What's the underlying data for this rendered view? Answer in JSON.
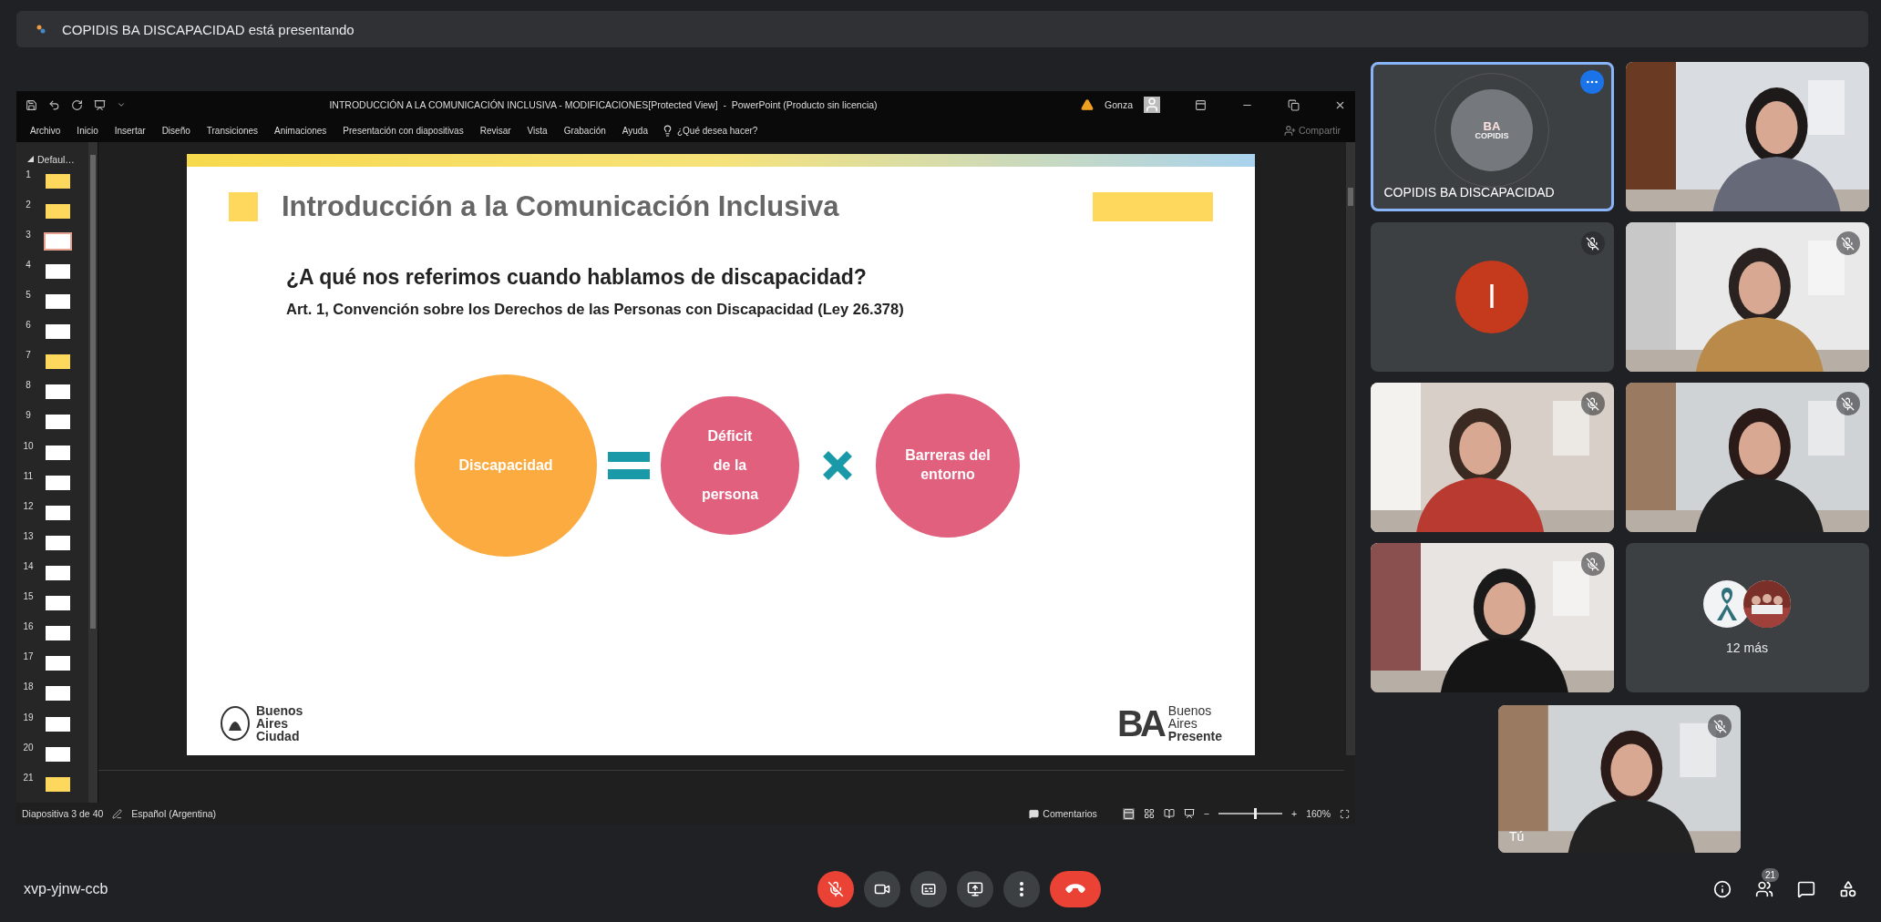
{
  "banner": {
    "text": "COPIDIS BA DISCAPACIDAD está presentando"
  },
  "powerpoint": {
    "title": "INTRODUCCIÓN A LA COMUNICACIÓN INCLUSIVA - MODIFICACIONES[Protected View]  -  PowerPoint (Producto sin licencia)",
    "user": "Gonza",
    "ribbon_tabs": [
      "Archivo",
      "Inicio",
      "Insertar",
      "Diseño",
      "Transiciones",
      "Animaciones",
      "Presentación con diapositivas",
      "Revisar",
      "Vista",
      "Grabación",
      "Ayuda"
    ],
    "tell_me": "¿Qué desea hacer?",
    "share": "Compartir",
    "section": "Defaul…",
    "thumbnails": [
      {
        "number": "1",
        "kind": "yellow",
        "selected": false
      },
      {
        "number": "2",
        "kind": "yellow",
        "selected": false
      },
      {
        "number": "3",
        "kind": "white",
        "selected": true
      },
      {
        "number": "4",
        "kind": "white",
        "selected": false
      },
      {
        "number": "5",
        "kind": "white",
        "selected": false
      },
      {
        "number": "6",
        "kind": "white",
        "selected": false
      },
      {
        "number": "7",
        "kind": "yellow",
        "selected": false
      },
      {
        "number": "8",
        "kind": "white",
        "selected": false
      },
      {
        "number": "9",
        "kind": "white",
        "selected": false
      },
      {
        "number": "10",
        "kind": "white",
        "selected": false
      },
      {
        "number": "11",
        "kind": "white",
        "selected": false
      },
      {
        "number": "12",
        "kind": "white",
        "selected": false
      },
      {
        "number": "13",
        "kind": "white",
        "selected": false
      },
      {
        "number": "14",
        "kind": "white",
        "selected": false
      },
      {
        "number": "15",
        "kind": "white",
        "selected": false
      },
      {
        "number": "16",
        "kind": "white",
        "selected": false
      },
      {
        "number": "17",
        "kind": "white",
        "selected": false
      },
      {
        "number": "18",
        "kind": "white",
        "selected": false
      },
      {
        "number": "19",
        "kind": "white",
        "selected": false
      },
      {
        "number": "20",
        "kind": "white",
        "selected": false
      },
      {
        "number": "21",
        "kind": "yellow",
        "selected": false
      }
    ],
    "slide": {
      "title": "Introducción a la Comunicación Inclusiva",
      "question": "¿A qué nos referimos cuando hablamos de discapacidad?",
      "reference": "Art. 1, Convención sobre los Derechos de las Personas con Discapacidad (Ley 26.378)",
      "equation": [
        {
          "kind": "circle",
          "lines": [
            "Discapacidad"
          ],
          "color": "#fbab3f"
        },
        {
          "kind": "equals"
        },
        {
          "kind": "circle",
          "lines": [
            "Déficit",
            "de la",
            "persona"
          ],
          "color": "#e0607e"
        },
        {
          "kind": "times"
        },
        {
          "kind": "circle",
          "lines": [
            "Barreras del",
            "entorno"
          ],
          "color": "#e0607e"
        }
      ],
      "logo_left": [
        "Buenos",
        "Aires",
        "Ciudad"
      ],
      "logo_right": {
        "mark": "BA",
        "lines": [
          "Buenos",
          "Aires",
          "Presente"
        ]
      }
    },
    "status_bar": {
      "slide_count": "Diapositiva 3 de 40",
      "language": "Español (Argentina)",
      "comments": "Comentarios",
      "zoom_minus": "−",
      "zoom_plus": "+",
      "zoom": {
        "level": 0.55
      },
      "zoom_reading": "160%"
    }
  },
  "participants": [
    {
      "kind": "logo",
      "name": "COPIDIS BA DISCAPACIDAD",
      "highlighted": true,
      "muted": false,
      "logo": {
        "mark": "BA",
        "name": "COPIDIS"
      }
    },
    {
      "kind": "video",
      "highlighted": false,
      "muted": false
    },
    {
      "kind": "avatar",
      "initial": "I",
      "color": "#c5391c",
      "highlighted": false,
      "muted": true
    },
    {
      "kind": "video",
      "highlighted": false,
      "muted": true
    },
    {
      "kind": "video",
      "highlighted": false,
      "muted": true
    },
    {
      "kind": "video",
      "highlighted": false,
      "muted": true
    },
    {
      "kind": "video",
      "highlighted": false,
      "muted": true
    },
    {
      "kind": "more",
      "label": "12 más",
      "highlighted": false,
      "muted": false
    }
  ],
  "self_view": {
    "name": "Tú",
    "muted": true
  },
  "meeting_code": "xvp-yjnw-ccb",
  "controls": [
    {
      "kind": "mic",
      "off": true
    },
    {
      "kind": "camera",
      "off": false
    },
    {
      "kind": "captions"
    },
    {
      "kind": "present"
    },
    {
      "kind": "more"
    },
    {
      "kind": "hangup"
    }
  ],
  "side_buttons": [
    {
      "kind": "info"
    },
    {
      "kind": "people",
      "badge": "21"
    },
    {
      "kind": "chat"
    },
    {
      "kind": "activities"
    }
  ]
}
